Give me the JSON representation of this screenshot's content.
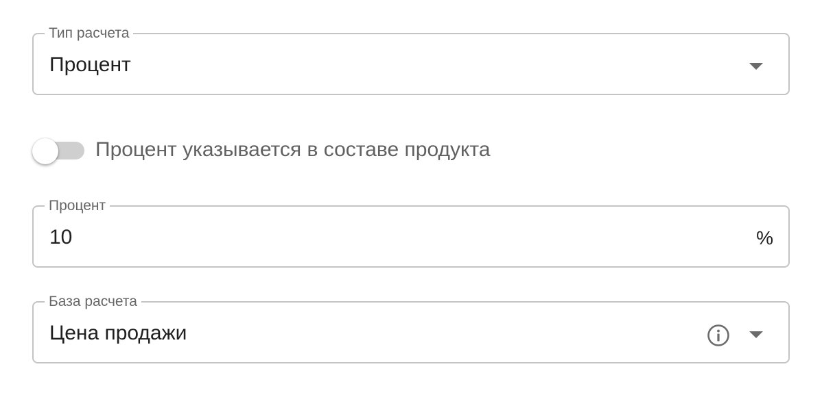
{
  "calc_type": {
    "label": "Тип расчета",
    "value": "Процент",
    "arrow_icon": "arrow-drop-down-icon"
  },
  "toggle": {
    "label": "Процент указывается в составе продукта",
    "checked": false
  },
  "percent": {
    "label": "Процент",
    "value": "10",
    "suffix": "%"
  },
  "calc_base": {
    "label": "База расчета",
    "value": "Цена продажи",
    "info_icon": "info-icon",
    "arrow_icon": "arrow-drop-down-icon"
  },
  "colors": {
    "border": "#c4c4c4",
    "label": "#666666",
    "text": "#1f1f1f",
    "icon": "#6b6b6b",
    "switch_track": "#cfcfcf"
  }
}
